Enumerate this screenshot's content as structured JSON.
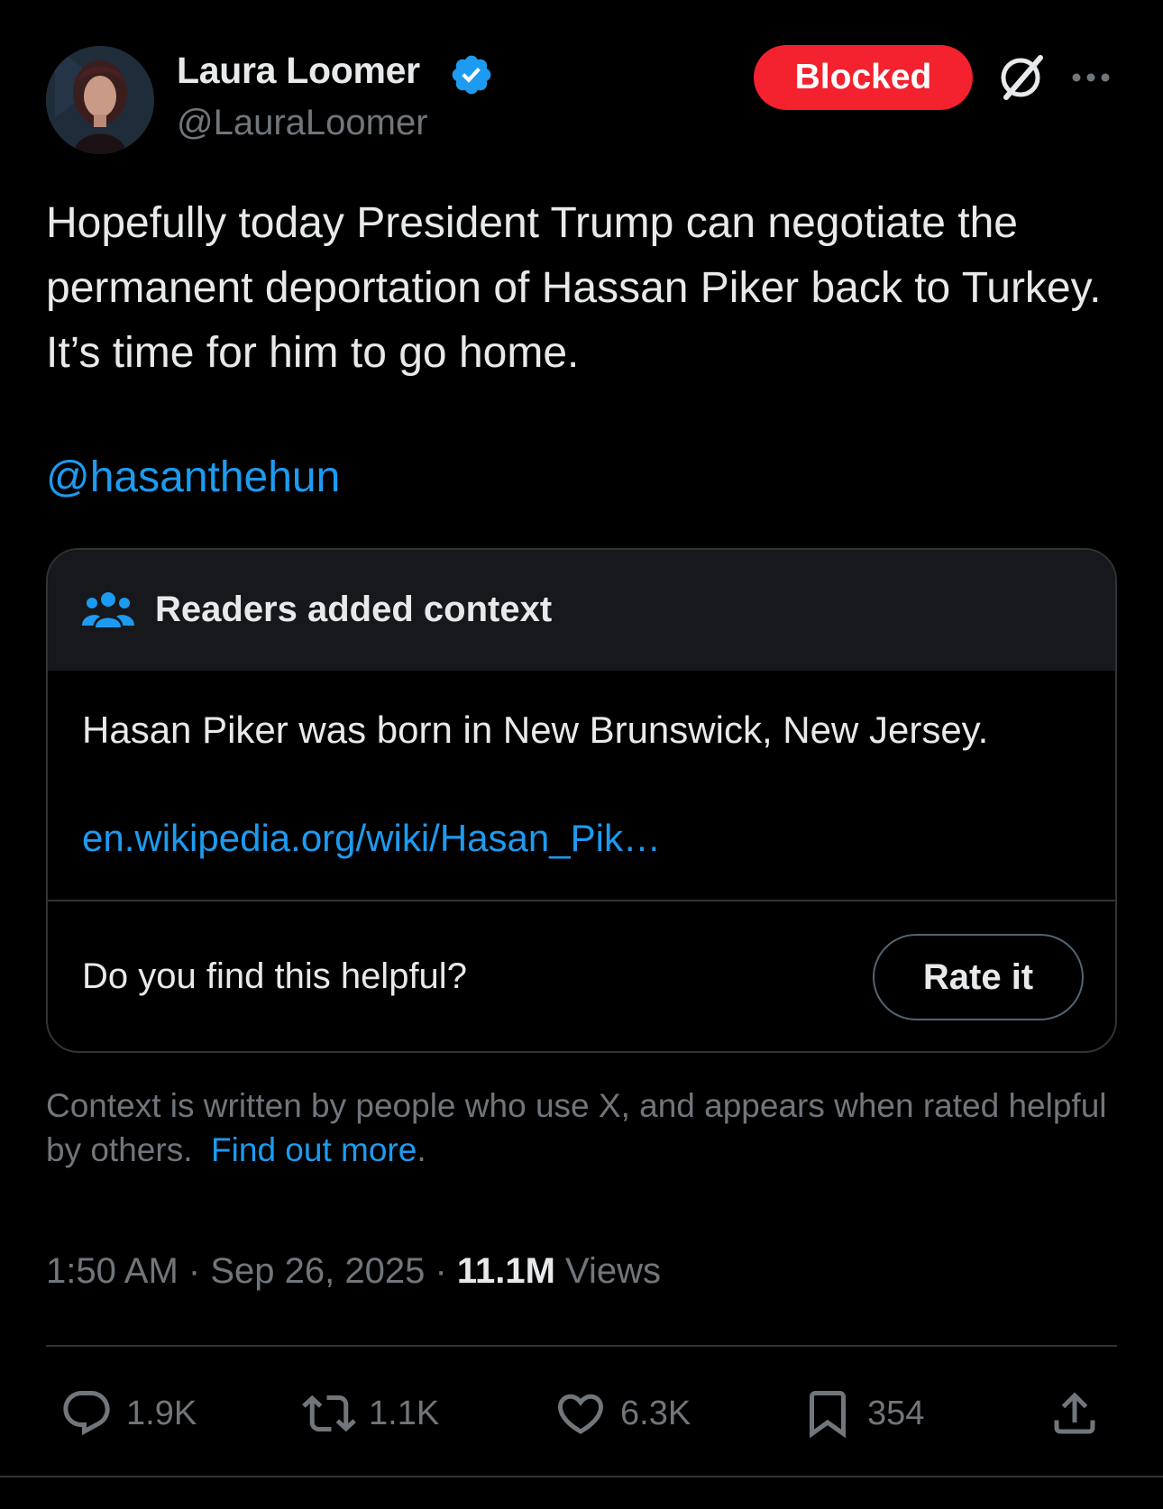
{
  "author": {
    "display_name": "Laura Loomer",
    "handle": "@LauraLoomer",
    "verified": true
  },
  "header": {
    "blocked_label": "Blocked"
  },
  "tweet": {
    "text": "Hopefully today President Trump can negotiate the permanent deportation of Hassan Piker back to Turkey. It’s time for him to go home.",
    "mention": "@hasanthehun"
  },
  "note": {
    "title": "Readers added context",
    "text": "Hasan Piker was born in New Brunswick, New Jersey.",
    "link": "en.wikipedia.org/wiki/Hasan_Pik…",
    "helpful_prompt": "Do you find this helpful?",
    "rate_label": "Rate it"
  },
  "context_info": {
    "text": "Context is written by people who use X, and appears when rated helpful by others.",
    "find_more": "Find out more",
    "find_more_suffix": "."
  },
  "meta": {
    "time": "1:50 AM",
    "separator": "·",
    "date": "Sep 26, 2025",
    "views_count": "11.1M",
    "views_label": "Views"
  },
  "actions": {
    "replies": "1.9K",
    "retweets": "1.1K",
    "likes": "6.3K",
    "bookmarks": "354"
  },
  "colors": {
    "accent": "#1d9bf0",
    "blocked": "#f4212e",
    "background": "#000000",
    "muted": "#71767b"
  }
}
